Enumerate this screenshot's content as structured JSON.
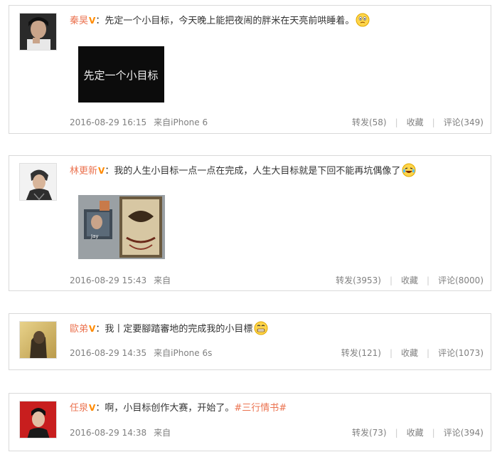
{
  "posts": [
    {
      "username": "秦昊",
      "verified": "V",
      "text": "：先定一个小目标，今天晚上能把夜闹的胖米在天亮前哄睡着。",
      "image_text": "先定一个小目标",
      "timestamp": "2016-08-29 16:15",
      "source": "来自iPhone 6",
      "repost": "转发(58)",
      "favorite": "收藏",
      "comment": "评论(349)"
    },
    {
      "username": "林更新",
      "verified": "V",
      "text": "：我的人生小目标一点一点在完成，人生大目标就是下回不能再坑偶像了",
      "album_text": "Jay",
      "timestamp": "2016-08-29 15:43",
      "source": "来自",
      "repost": "转发(3953)",
      "favorite": "收藏",
      "comment": "评论(8000)"
    },
    {
      "username": "歐弟",
      "verified": "V",
      "text": "：我丨定要腳踏審地的完成我的小目標",
      "timestamp": "2016-08-29 14:35",
      "source": "来自iPhone 6s",
      "repost": "转发(121)",
      "favorite": "收藏",
      "comment": "评论(1073)"
    },
    {
      "username": "任泉",
      "verified": "V",
      "text": "：啊，小目标创作大赛，开始了。",
      "hashtag": "#三行情书#",
      "timestamp": "2016-08-29 14:38",
      "source": "来自",
      "repost": "转发(73)",
      "favorite": "收藏",
      "comment": "评论(394)"
    }
  ]
}
